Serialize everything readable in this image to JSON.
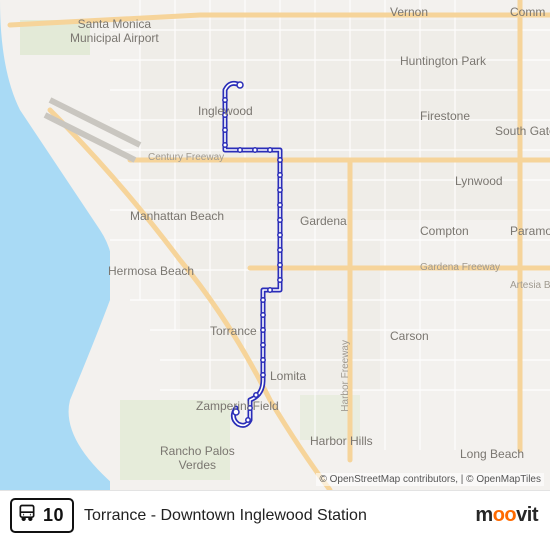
{
  "route": {
    "badge_number": "10",
    "name": "Torrance - Downtown Inglewood Station",
    "icon": "bus-icon",
    "line_color": "#2a2db8"
  },
  "brand": {
    "pre": "m",
    "mid": "oo",
    "post": "vit"
  },
  "attribution": "© OpenStreetMap contributors, | © OpenMapTiles",
  "labels": {
    "santa_monica_airport": "Santa Monica\nMunicipal Airport",
    "vernon": "Vernon",
    "comm": "Comm",
    "huntington_park": "Huntington Park",
    "inglewood": "Inglewood",
    "firestone": "Firestone",
    "south_gate": "South Gate",
    "century_fwy": "Century Freeway",
    "lynwood": "Lynwood",
    "manhattan_beach": "Manhattan Beach",
    "gardena": "Gardena",
    "compton": "Compton",
    "paramount": "Paramou",
    "hermosa_beach": "Hermosa Beach",
    "gardena_fwy": "Gardena Freeway",
    "artesia_blvd": "Artesia Blvd",
    "torrance": "Torrance",
    "carson": "Carson",
    "lomita": "Lomita",
    "zamperini": "Zamperini Field",
    "harbor_fwy": "Harbor Freeway",
    "palos_verdes": "Rancho Palos\nVerdes",
    "harbor_hills": "Harbor Hills",
    "long_beach": "Long Beach"
  }
}
